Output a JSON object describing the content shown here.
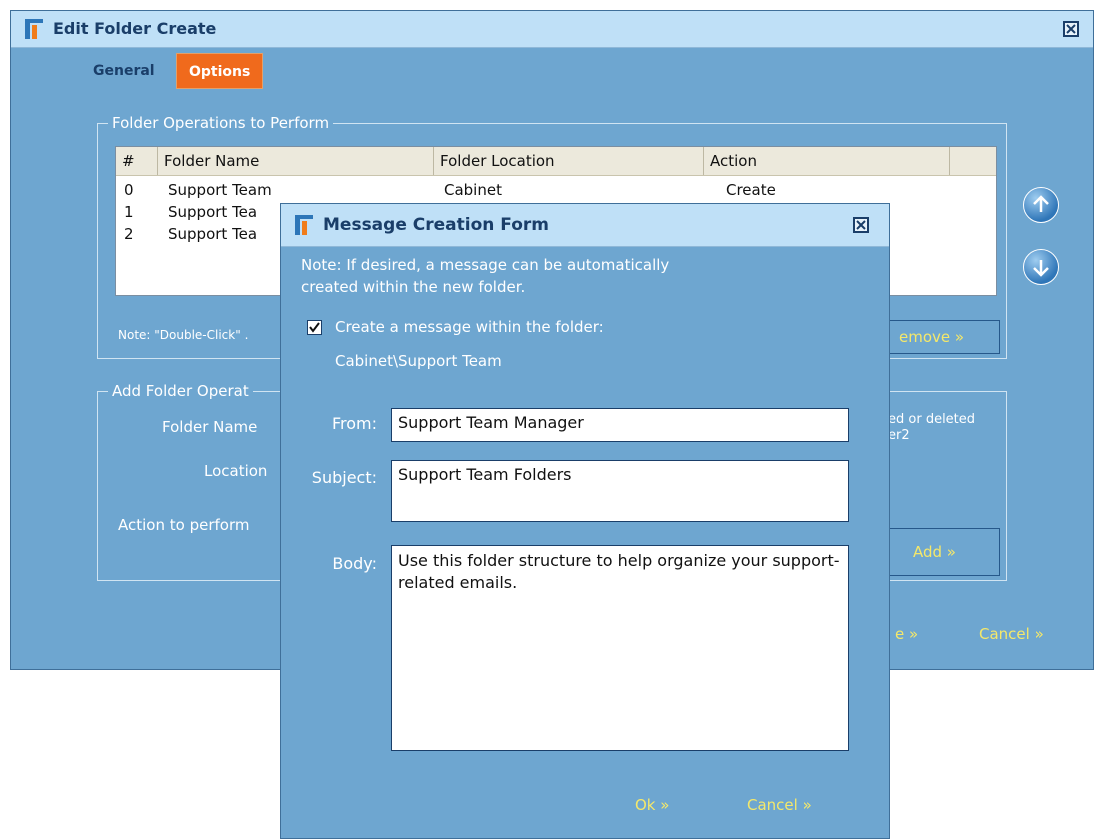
{
  "main_window": {
    "title": "Edit Folder Create",
    "tabs": [
      {
        "label": "General",
        "active": false
      },
      {
        "label": "Options",
        "active": true
      }
    ],
    "operations_group": {
      "legend": "Folder Operations to Perform",
      "columns": [
        "#",
        "Folder Name",
        "Folder Location",
        "Action"
      ],
      "rows": [
        {
          "num": "0",
          "name": "Support Team",
          "location": "Cabinet",
          "action": "Create"
        },
        {
          "num": "1",
          "name": "Support Tea",
          "location": "",
          "action": ""
        },
        {
          "num": "2",
          "name": "Support Tea",
          "location": "",
          "action": ""
        }
      ],
      "note": "Note: \"Double-Click\" .",
      "remove_label": "emove »"
    },
    "add_group": {
      "legend": "Add Folder Operat",
      "folder_name_label": "Folder Name",
      "location_label": "Location",
      "action_label": "Action to perform",
      "side_note_line1": "ed or deleted",
      "side_note_line2": "er2",
      "add_label": "Add »"
    },
    "footer": {
      "save_fragment": "e »",
      "cancel_label": "Cancel »"
    }
  },
  "modal": {
    "title": "Message Creation Form",
    "note_line1": "Note: If desired, a message can be automatically",
    "note_line2": "created within the new folder.",
    "checkbox_label": "Create a message within the folder:",
    "checkbox_checked": true,
    "folder_path": "Cabinet\\Support Team",
    "from_label": "From:",
    "from_value": "Support Team Manager",
    "subject_label": "Subject:",
    "subject_value": "Support Team Folders",
    "body_label": "Body:",
    "body_value": "Use this folder structure to help organize your support-related emails.",
    "ok_label": "Ok »",
    "cancel_label": "Cancel »"
  },
  "colors": {
    "panel_bg": "#6ea6d0",
    "titlebar_bg": "#bfe0f7",
    "active_tab": "#f06a1c",
    "link_yellow": "#f5e86a"
  },
  "icons": [
    "app-logo-icon",
    "close-icon",
    "arrow-up-icon",
    "arrow-down-icon",
    "checkmark-icon"
  ]
}
